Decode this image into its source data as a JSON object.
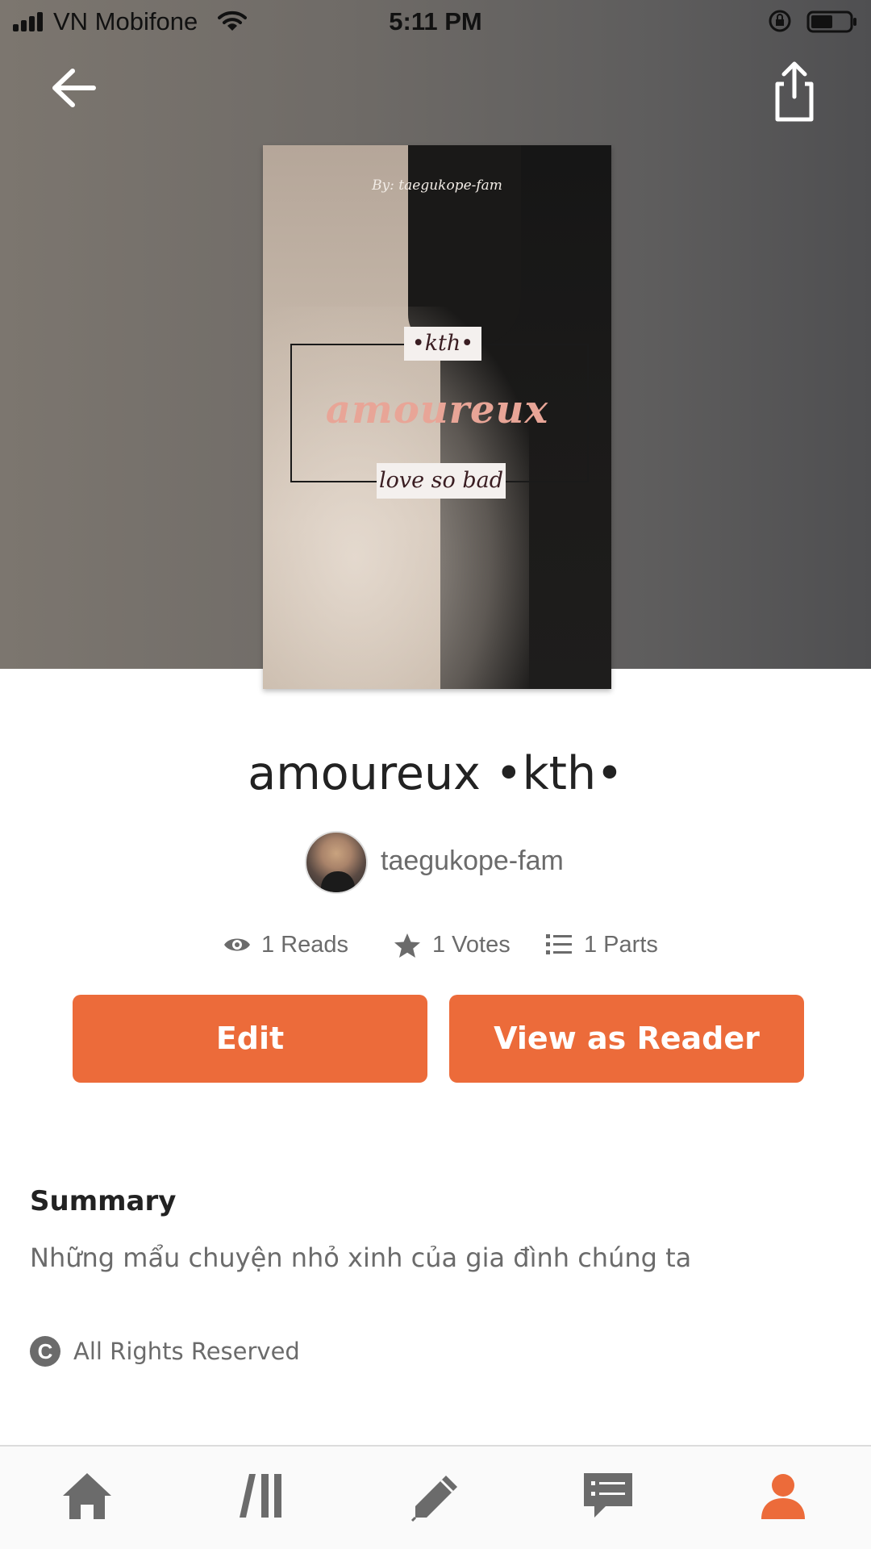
{
  "status_bar": {
    "carrier": "VN Mobifone",
    "time": "5:11 PM"
  },
  "header": {
    "back_icon": "arrow-left-icon",
    "share_icon": "share-icon"
  },
  "cover": {
    "byline": "By: taegukope-fam",
    "top_label": "•kth•",
    "title_text": "amoureux",
    "bottom_label": "love so bad"
  },
  "story": {
    "title": "amoureux •kth•",
    "author": "taegukope-fam",
    "stats": {
      "reads": "1 Reads",
      "votes": "1 Votes",
      "parts": "1 Parts"
    }
  },
  "actions": {
    "edit_label": "Edit",
    "reader_label": "View as Reader"
  },
  "summary": {
    "heading": "Summary",
    "text": "Những mẩu chuyện nhỏ xinh của gia đình chúng ta",
    "rights": "All Rights Reserved"
  },
  "colors": {
    "accent": "#ec6b3a",
    "text_primary": "#222222",
    "text_secondary": "#6b6b6b"
  },
  "tabbar": {
    "items": [
      "home-icon",
      "library-icon",
      "pencil-icon",
      "messages-icon",
      "profile-icon"
    ],
    "active": "profile-icon"
  }
}
